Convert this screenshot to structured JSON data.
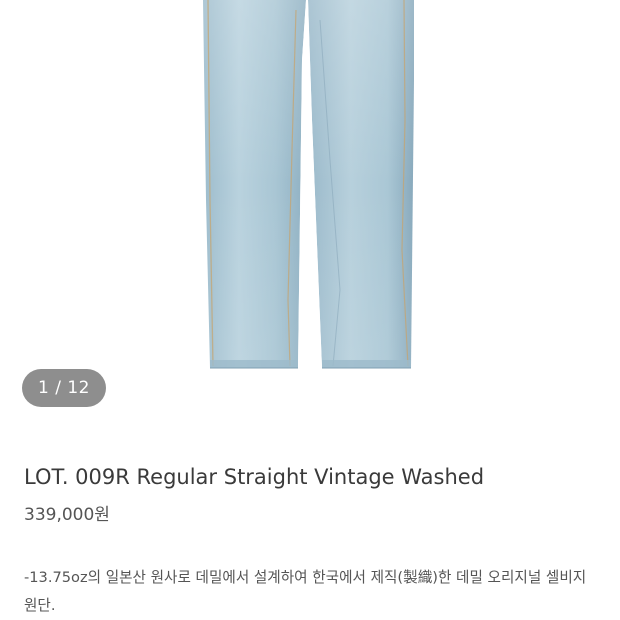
{
  "gallery": {
    "counter": "1 / 12",
    "image_alt": "jeans-photo"
  },
  "product": {
    "title": "LOT. 009R Regular Straight Vintage Washed",
    "price": "339,000원",
    "description": "-13.75oz의 일본산 원사로 데밀에서 설계하여 한국에서 제직(製織)한 데밀 오리지널 셀비지 원단."
  },
  "colors": {
    "denim_light": "#aecad6",
    "denim_mid": "#8fb2c4",
    "seam": "#c7a36b",
    "badge_bg": "#8e8e8e"
  }
}
